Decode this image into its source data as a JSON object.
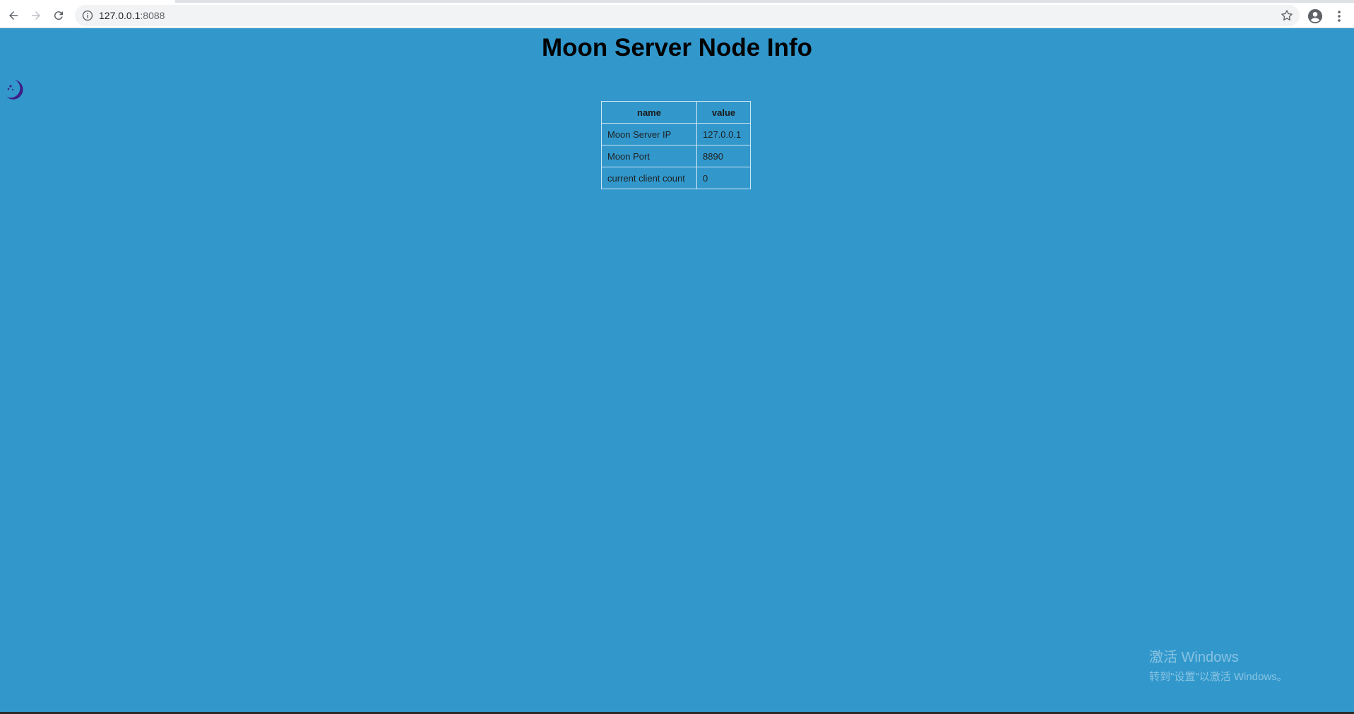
{
  "browser": {
    "url_host": "127.0.0.1",
    "url_port": ":8088",
    "icons": [
      "back-arrow-icon",
      "forward-arrow-icon",
      "reload-icon",
      "info-icon",
      "star-icon",
      "profile-icon",
      "menu-dots-icon"
    ]
  },
  "page": {
    "title": "Moon Server Node Info",
    "logo_icon": "moon-icon",
    "background_color": "#3298cc"
  },
  "table": {
    "headers": [
      "name",
      "value"
    ],
    "rows": [
      [
        "Moon Server IP",
        "127.0.0.1"
      ],
      [
        "Moon Port",
        "8890"
      ],
      [
        "current client count",
        "0"
      ]
    ]
  },
  "watermark": {
    "line1": "激活 Windows",
    "line2": "转到\"设置\"以激活 Windows。"
  }
}
